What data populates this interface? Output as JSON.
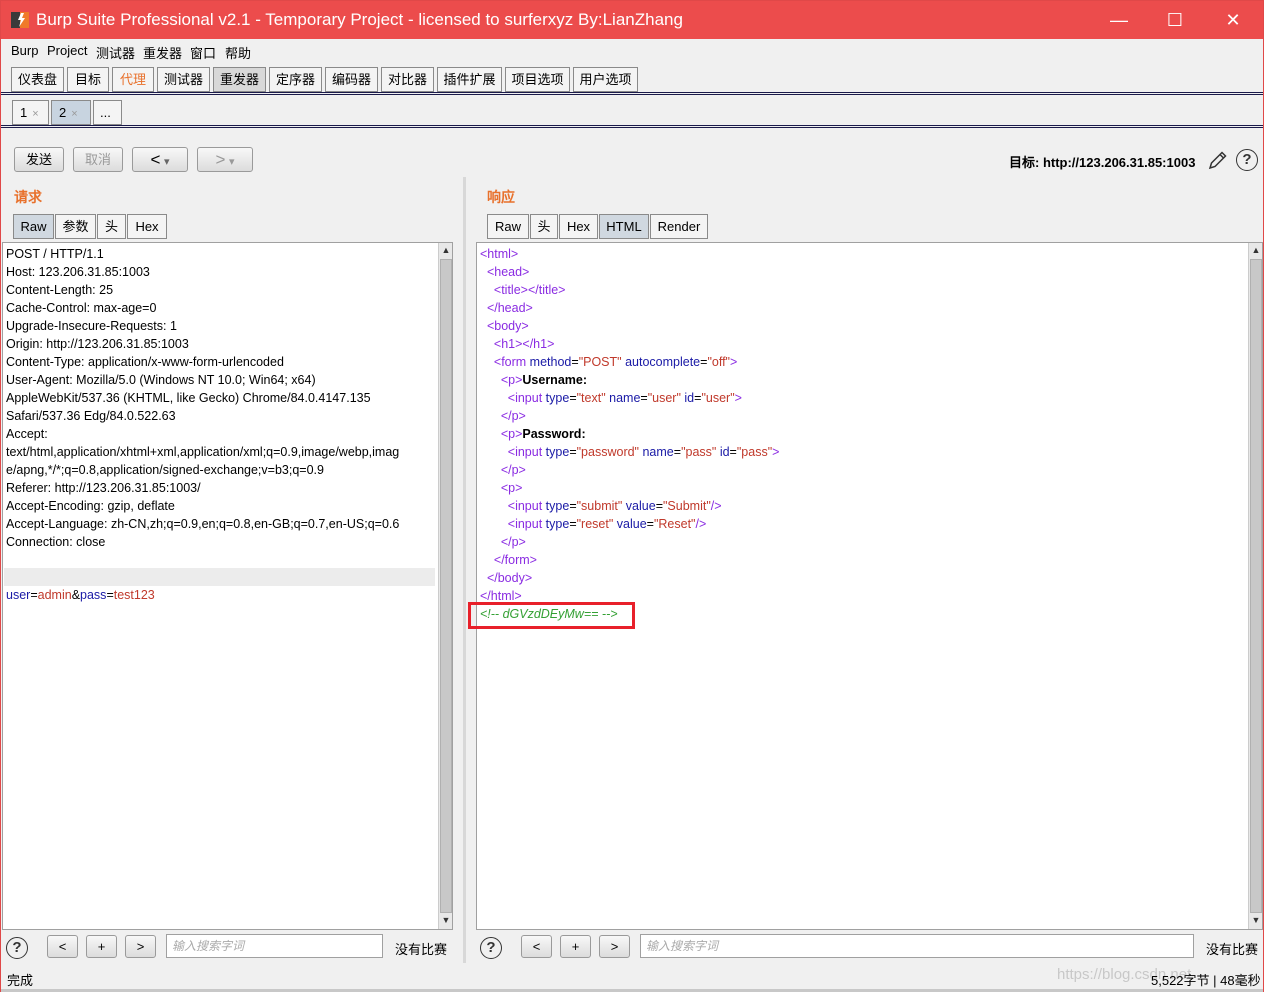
{
  "window": {
    "title": "Burp Suite Professional v2.1 - Temporary Project - licensed to surferxyz By:LianZhang",
    "minimize": "—",
    "maximize": "☐",
    "close": "✕"
  },
  "menu": [
    "Burp",
    "Project",
    "测试器",
    "重发器",
    "窗口",
    "帮助"
  ],
  "top_tabs": [
    "仪表盘",
    "目标",
    "代理",
    "测试器",
    "重发器",
    "定序器",
    "编码器",
    "对比器",
    "插件扩展",
    "项目选项",
    "用户选项"
  ],
  "sub_tabs": [
    {
      "label": "1",
      "close": "×"
    },
    {
      "label": "2",
      "close": "×"
    },
    {
      "label": "..."
    }
  ],
  "toolbar": {
    "send": "发送",
    "cancel": "取消",
    "back": "<",
    "forward": ">",
    "dropdown": "▾",
    "target": "目标: http://123.206.31.85:1003",
    "help": "?"
  },
  "request": {
    "heading": "请求",
    "tabs": [
      "Raw",
      "参数",
      "头",
      "Hex"
    ],
    "lines": [
      "POST / HTTP/1.1",
      "Host: 123.206.31.85:1003",
      "Content-Length: 25",
      "Cache-Control: max-age=0",
      "Upgrade-Insecure-Requests: 1",
      "Origin: http://123.206.31.85:1003",
      "Content-Type: application/x-www-form-urlencoded",
      "User-Agent: Mozilla/5.0 (Windows NT 10.0; Win64; x64)",
      "AppleWebKit/537.36 (KHTML, like Gecko) Chrome/84.0.4147.135",
      "Safari/537.36 Edg/84.0.522.63",
      "Accept:",
      "text/html,application/xhtml+xml,application/xml;q=0.9,image/webp,imag",
      "e/apng,*/*;q=0.8,application/signed-exchange;v=b3;q=0.9",
      "Referer: http://123.206.31.85:1003/",
      "Accept-Encoding: gzip, deflate",
      "Accept-Language: zh-CN,zh;q=0.9,en;q=0.8,en-GB;q=0.7,en-US;q=0.6",
      "Connection: close"
    ],
    "body_parts": [
      {
        "t": "user",
        "c": "pkey"
      },
      {
        "t": "=",
        "c": ""
      },
      {
        "t": "admin",
        "c": "pval"
      },
      {
        "t": "&",
        "c": ""
      },
      {
        "t": "pass",
        "c": "pkey"
      },
      {
        "t": "=",
        "c": ""
      },
      {
        "t": "test123",
        "c": "pval"
      }
    ]
  },
  "response": {
    "heading": "响应",
    "tabs": [
      "Raw",
      "头",
      "Hex",
      "HTML",
      "Render"
    ],
    "lines": [
      [
        {
          "t": "<html>",
          "c": "tag"
        }
      ],
      [
        {
          "t": "  <head>",
          "c": "tag"
        }
      ],
      [
        {
          "t": "    <title></title>",
          "c": "tag"
        }
      ],
      [
        {
          "t": "  </head>",
          "c": "tag"
        }
      ],
      [
        {
          "t": "  <body>",
          "c": "tag"
        }
      ],
      [
        {
          "t": "    <h1></h1>",
          "c": "tag"
        }
      ],
      [
        {
          "t": "    <form ",
          "c": "tag"
        },
        {
          "t": "method",
          "c": "attrn"
        },
        {
          "t": "=",
          "c": ""
        },
        {
          "t": "\"POST\"",
          "c": "attrv"
        },
        {
          "t": " autocomplete",
          "c": "attrn"
        },
        {
          "t": "=",
          "c": ""
        },
        {
          "t": "\"off\"",
          "c": "attrv"
        },
        {
          "t": ">",
          "c": "tag"
        }
      ],
      [
        {
          "t": "      <p>",
          "c": "tag"
        },
        {
          "t": "Username:",
          "c": "bold"
        }
      ],
      [
        {
          "t": "        <input ",
          "c": "tag"
        },
        {
          "t": "type",
          "c": "attrn"
        },
        {
          "t": "=",
          "c": ""
        },
        {
          "t": "\"text\"",
          "c": "attrv"
        },
        {
          "t": " name",
          "c": "attrn"
        },
        {
          "t": "=",
          "c": ""
        },
        {
          "t": "\"user\"",
          "c": "attrv"
        },
        {
          "t": " id",
          "c": "attrn"
        },
        {
          "t": "=",
          "c": ""
        },
        {
          "t": "\"user\"",
          "c": "attrv"
        },
        {
          "t": ">",
          "c": "tag"
        }
      ],
      [
        {
          "t": "      </p>",
          "c": "tag"
        }
      ],
      [
        {
          "t": "      <p>",
          "c": "tag"
        },
        {
          "t": "Password:",
          "c": "bold"
        }
      ],
      [
        {
          "t": "        <input ",
          "c": "tag"
        },
        {
          "t": "type",
          "c": "attrn"
        },
        {
          "t": "=",
          "c": ""
        },
        {
          "t": "\"password\"",
          "c": "attrv"
        },
        {
          "t": " name",
          "c": "attrn"
        },
        {
          "t": "=",
          "c": ""
        },
        {
          "t": "\"pass\"",
          "c": "attrv"
        },
        {
          "t": " id",
          "c": "attrn"
        },
        {
          "t": "=",
          "c": ""
        },
        {
          "t": "\"pass\"",
          "c": "attrv"
        },
        {
          "t": ">",
          "c": "tag"
        }
      ],
      [
        {
          "t": "      </p>",
          "c": "tag"
        }
      ],
      [
        {
          "t": "      <p>",
          "c": "tag"
        }
      ],
      [
        {
          "t": "        <input ",
          "c": "tag"
        },
        {
          "t": "type",
          "c": "attrn"
        },
        {
          "t": "=",
          "c": ""
        },
        {
          "t": "\"submit\"",
          "c": "attrv"
        },
        {
          "t": " value",
          "c": "attrn"
        },
        {
          "t": "=",
          "c": ""
        },
        {
          "t": "\"Submit\"",
          "c": "attrv"
        },
        {
          "t": "/>",
          "c": "tag"
        }
      ],
      [
        {
          "t": "        <input ",
          "c": "tag"
        },
        {
          "t": "type",
          "c": "attrn"
        },
        {
          "t": "=",
          "c": ""
        },
        {
          "t": "\"reset\"",
          "c": "attrv"
        },
        {
          "t": " value",
          "c": "attrn"
        },
        {
          "t": "=",
          "c": ""
        },
        {
          "t": "\"Reset\"",
          "c": "attrv"
        },
        {
          "t": "/>",
          "c": "tag"
        }
      ],
      [
        {
          "t": "      </p>",
          "c": "tag"
        }
      ],
      [
        {
          "t": "    </form>",
          "c": "tag"
        }
      ],
      [
        {
          "t": "  </body>",
          "c": "tag"
        }
      ],
      [
        {
          "t": "</html>",
          "c": "tag"
        }
      ],
      [
        {
          "t": "<!-- dGVzdDEyMw== -->",
          "c": "cmt"
        }
      ]
    ]
  },
  "footer": {
    "help": "?",
    "prev": "<",
    "add": "+",
    "next": ">",
    "search_placeholder": "输入搜索字词",
    "no_match": "没有比赛",
    "status": "完成",
    "stats": "5,522字节 | 48毫秒",
    "watermark": "https://blog.csdn.net"
  },
  "colors": {
    "titlebar": "#ec4c4c",
    "accent_orange": "#e8712c",
    "highlight_box": "#e8202a",
    "html_tag": "#8a2be2",
    "html_attr": "#1a1aa6",
    "html_value": "#c0392b",
    "html_comment": "#33a033"
  }
}
